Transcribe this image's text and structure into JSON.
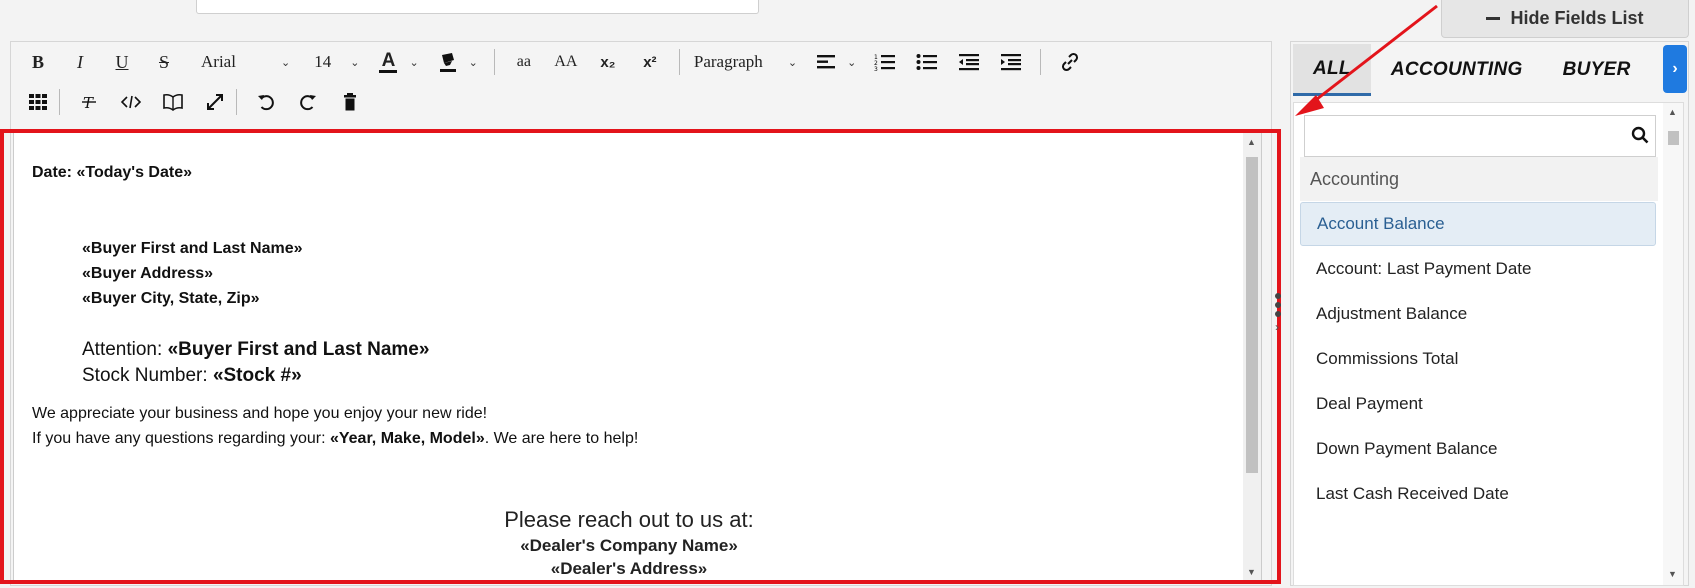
{
  "top": {
    "label_stub": "",
    "input_stub": "",
    "hide_fields_label": "Hide Fields List"
  },
  "toolbar": {
    "bold": "B",
    "italic": "I",
    "underline": "U",
    "strike": "S",
    "font_family": "Arial",
    "font_size": "14",
    "lowercase": "aa",
    "uppercase": "AA",
    "subscript": "x₂",
    "superscript": "x²",
    "block_format": "Paragraph"
  },
  "document": {
    "date_label": "Date: ",
    "date_field": "«Today's Date»",
    "buyer_name": "«Buyer First and Last Name»",
    "buyer_address": "«Buyer Address»",
    "buyer_city": "«Buyer City, State, Zip»",
    "attention_label": "Attention: ",
    "attention_field": "«Buyer First and Last Name»",
    "stock_label": "Stock Number: ",
    "stock_field": "«Stock #»",
    "para1": "We appreciate your business and hope you enjoy your new ride!",
    "para2_pre": "If you have any questions regarding your: ",
    "para2_field": "«Year, Make, Model»",
    "para2_post": ". We are here to help!",
    "reach_out": "Please reach out to us at:",
    "dealer_name": "«Dealer's Company Name»",
    "dealer_address": "«Dealer's Address»"
  },
  "panel": {
    "tabs": [
      "ALL",
      "ACCOUNTING",
      "BUYER"
    ],
    "next_tab": "›",
    "search_placeholder": "",
    "group": "Accounting",
    "items": [
      "Account Balance",
      "Account: Last Payment Date",
      "Adjustment Balance",
      "Commissions Total",
      "Deal Payment",
      "Down Payment Balance",
      "Last Cash Received Date"
    ]
  },
  "colors": {
    "annotation": "#e3141b",
    "accent": "#1f7ae0",
    "selected_bg": "#e4edf5"
  }
}
